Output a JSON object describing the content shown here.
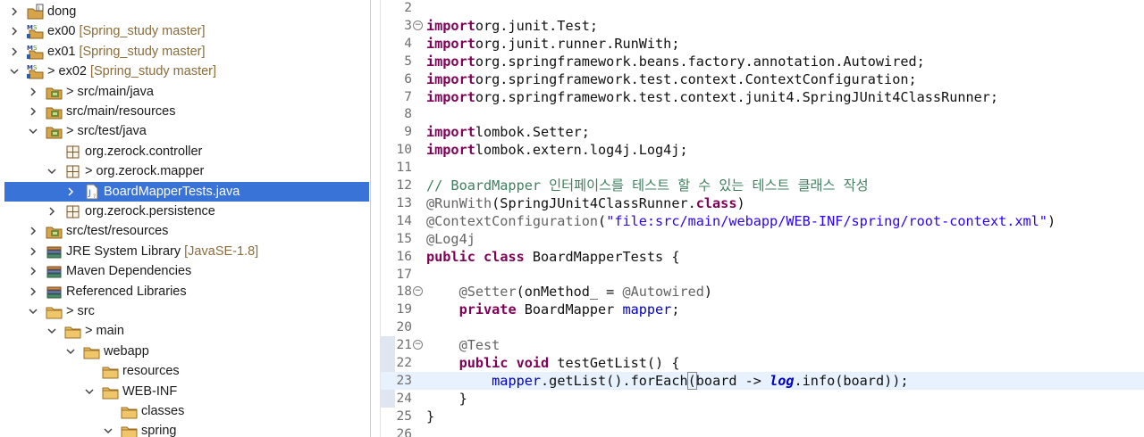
{
  "explorer": {
    "selected": "BoardMapperTests.java",
    "rows": [
      {
        "label": "dong",
        "prefix": "",
        "decoration": "",
        "icon": "project-java-icon",
        "chevron": "right",
        "indent": 0
      },
      {
        "label": "ex00",
        "prefix": "",
        "decoration": "[Spring_study master]",
        "icon": "maven-project-icon",
        "chevron": "right",
        "indent": 0
      },
      {
        "label": "ex01",
        "prefix": "",
        "decoration": "[Spring_study master]",
        "icon": "maven-project-icon",
        "chevron": "right",
        "indent": 0
      },
      {
        "label": "ex02",
        "prefix": "> ",
        "decoration": "[Spring_study master]",
        "icon": "maven-project-icon",
        "chevron": "down",
        "indent": 0
      },
      {
        "label": "src/main/java",
        "prefix": "> ",
        "decoration": "",
        "icon": "source-folder-icon",
        "chevron": "right",
        "indent": 1
      },
      {
        "label": "src/main/resources",
        "prefix": "",
        "decoration": "",
        "icon": "source-folder-icon",
        "chevron": "right",
        "indent": 1
      },
      {
        "label": "src/test/java",
        "prefix": "> ",
        "decoration": "",
        "icon": "source-folder-icon",
        "chevron": "down",
        "indent": 1
      },
      {
        "label": "org.zerock.controller",
        "prefix": "",
        "decoration": "",
        "icon": "package-icon",
        "chevron": "none",
        "indent": 2
      },
      {
        "label": "org.zerock.mapper",
        "prefix": "> ",
        "decoration": "",
        "icon": "package-icon",
        "chevron": "down",
        "indent": 2
      },
      {
        "label": "BoardMapperTests.java",
        "prefix": "",
        "decoration": "",
        "icon": "java-file-icon",
        "chevron": "right",
        "indent": 3
      },
      {
        "label": "org.zerock.persistence",
        "prefix": "",
        "decoration": "",
        "icon": "package-icon",
        "chevron": "right",
        "indent": 2
      },
      {
        "label": "src/test/resources",
        "prefix": "",
        "decoration": "",
        "icon": "source-folder-icon",
        "chevron": "right",
        "indent": 1
      },
      {
        "label": "JRE System Library",
        "prefix": "",
        "decoration": "[JavaSE-1.8]",
        "icon": "library-icon",
        "chevron": "right",
        "indent": 1
      },
      {
        "label": "Maven Dependencies",
        "prefix": "",
        "decoration": "",
        "icon": "library-icon",
        "chevron": "right",
        "indent": 1
      },
      {
        "label": "Referenced Libraries",
        "prefix": "",
        "decoration": "",
        "icon": "library-icon",
        "chevron": "right",
        "indent": 1
      },
      {
        "label": "src",
        "prefix": "> ",
        "decoration": "",
        "icon": "folder-icon",
        "chevron": "down",
        "indent": 1
      },
      {
        "label": "main",
        "prefix": "> ",
        "decoration": "",
        "icon": "folder-icon",
        "chevron": "down",
        "indent": 2
      },
      {
        "label": "webapp",
        "prefix": "",
        "decoration": "",
        "icon": "folder-icon",
        "chevron": "down",
        "indent": 3
      },
      {
        "label": "resources",
        "prefix": "",
        "decoration": "",
        "icon": "folder-icon",
        "chevron": "none",
        "indent": 4
      },
      {
        "label": "WEB-INF",
        "prefix": "",
        "decoration": "",
        "icon": "folder-icon",
        "chevron": "down",
        "indent": 4
      },
      {
        "label": "classes",
        "prefix": "",
        "decoration": "",
        "icon": "folder-icon",
        "chevron": "none",
        "indent": 5
      },
      {
        "label": "spring",
        "prefix": "",
        "decoration": "",
        "icon": "folder-icon",
        "chevron": "down",
        "indent": 5
      }
    ]
  },
  "editor": {
    "first_line": 2,
    "current_line": 23,
    "fold_markers": [
      3,
      18,
      21
    ],
    "lines": [
      [],
      [
        [
          "kw",
          "import"
        ],
        [
          "",
          "org.junit.Test;"
        ]
      ],
      [
        [
          "kw",
          "import"
        ],
        [
          "",
          "org.junit.runner.RunWith;"
        ]
      ],
      [
        [
          "kw",
          "import"
        ],
        [
          "",
          "org.springframework.beans.factory.annotation.Autowired;"
        ]
      ],
      [
        [
          "kw",
          "import"
        ],
        [
          "",
          "org.springframework.test.context.ContextConfiguration;"
        ]
      ],
      [
        [
          "kw",
          "import"
        ],
        [
          "",
          "org.springframework.test.context.junit4.SpringJUnit4ClassRunner;"
        ]
      ],
      [],
      [
        [
          "kw",
          "import"
        ],
        [
          "",
          "lombok.Setter;"
        ]
      ],
      [
        [
          "kw",
          "import"
        ],
        [
          "",
          "lombok.extern.log4j.Log4j;"
        ]
      ],
      [],
      [
        [
          "cm",
          "// BoardMapper 인터페이스를 테스트 할 수 있는 테스트 클래스 작성"
        ]
      ],
      [
        [
          "ann",
          "@RunWith"
        ],
        [
          "",
          "(SpringJUnit4ClassRunner."
        ],
        [
          "kw",
          "class"
        ],
        [
          "",
          ")"
        ]
      ],
      [
        [
          "ann",
          "@ContextConfiguration"
        ],
        [
          "",
          "("
        ],
        [
          "str",
          "\"file:src/main/webapp/WEB-INF/spring/root-context.xml\""
        ],
        [
          "",
          ")"
        ]
      ],
      [
        [
          "ann",
          "@Log4j"
        ]
      ],
      [
        [
          "kw",
          "public"
        ],
        [
          "",
          " "
        ],
        [
          "kw",
          "class"
        ],
        [
          "",
          " BoardMapperTests {"
        ]
      ],
      [],
      [
        [
          "",
          "    "
        ],
        [
          "ann",
          "@Setter"
        ],
        [
          "",
          "(onMethod_ = "
        ],
        [
          "ann",
          "@Autowired"
        ],
        [
          "",
          ")"
        ]
      ],
      [
        [
          "",
          "    "
        ],
        [
          "kw",
          "private"
        ],
        [
          "",
          " BoardMapper "
        ],
        [
          "fld",
          "mapper"
        ],
        [
          "",
          ";"
        ]
      ],
      [],
      [
        [
          "",
          "    "
        ],
        [
          "ann",
          "@Test"
        ]
      ],
      [
        [
          "",
          "    "
        ],
        [
          "kw",
          "public"
        ],
        [
          "",
          " "
        ],
        [
          "kw",
          "void"
        ],
        [
          "",
          " testGetList() {"
        ]
      ],
      [
        [
          "",
          "        "
        ],
        [
          "fld",
          "mapper"
        ],
        [
          "",
          ".getList().forEach"
        ],
        [
          "brk",
          "("
        ],
        [
          "",
          "board -> "
        ],
        [
          "sfld",
          "log"
        ],
        [
          "",
          ".info(board));"
        ]
      ],
      [
        [
          "",
          "    }"
        ]
      ],
      [
        [
          "",
          "}"
        ]
      ],
      []
    ]
  }
}
